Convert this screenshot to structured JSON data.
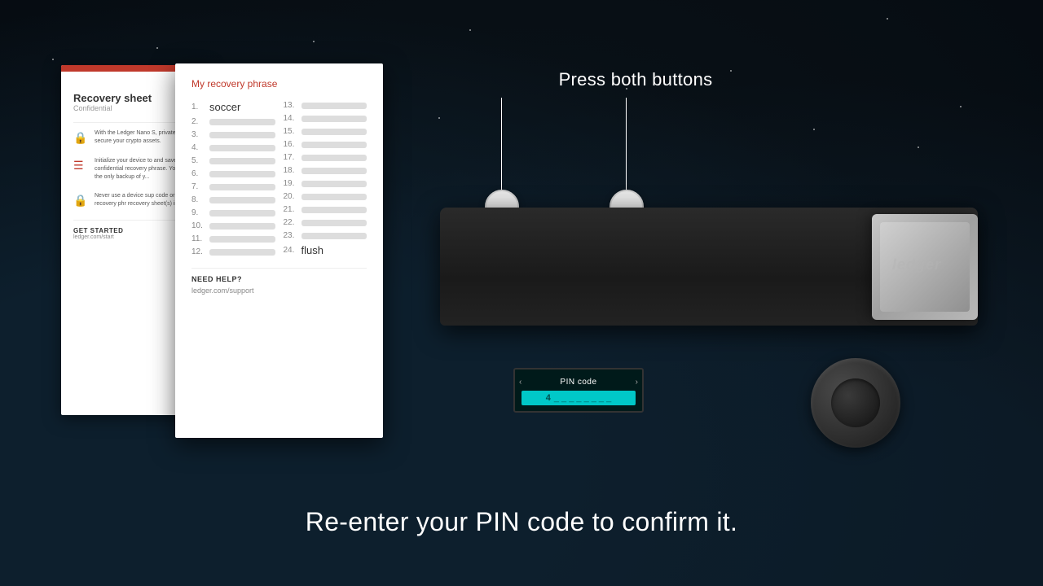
{
  "background": {
    "color": "#0a1520"
  },
  "recovery_sheet_back": {
    "title": "Recovery sheet",
    "subtitle": "Confidential",
    "section1_text": "With the Ledger Nano S, private keys to secure your crypto assets.",
    "section2_text": "Initialize your device to and save your confidential recovery phrase. Your is the only backup of y...",
    "section3_text": "Never use a device sup code or a recovery phr recovery sheet(s) in a s...",
    "get_started_label": "GET STARTED",
    "get_started_link": "ledger.com/start"
  },
  "recovery_card": {
    "title": "My recovery phrase",
    "word1": "soccer",
    "word24": "flush",
    "help_label": "NEED HELP?",
    "help_link": "ledger.com/support",
    "words": [
      {
        "num": "1.",
        "word": "soccer",
        "visible": true
      },
      {
        "num": "2.",
        "word": "",
        "visible": false
      },
      {
        "num": "3.",
        "word": "",
        "visible": false
      },
      {
        "num": "4.",
        "word": "",
        "visible": false
      },
      {
        "num": "5.",
        "word": "",
        "visible": false
      },
      {
        "num": "6.",
        "word": "",
        "visible": false
      },
      {
        "num": "7.",
        "word": "",
        "visible": false
      },
      {
        "num": "8.",
        "word": "",
        "visible": false
      },
      {
        "num": "9.",
        "word": "",
        "visible": false
      },
      {
        "num": "10.",
        "word": "",
        "visible": false
      },
      {
        "num": "11.",
        "word": "",
        "visible": false
      },
      {
        "num": "12.",
        "word": "",
        "visible": false
      },
      {
        "num": "13.",
        "word": "",
        "visible": false
      },
      {
        "num": "14.",
        "word": "",
        "visible": false
      },
      {
        "num": "15.",
        "word": "",
        "visible": false
      },
      {
        "num": "16.",
        "word": "",
        "visible": false
      },
      {
        "num": "17.",
        "word": "",
        "visible": false
      },
      {
        "num": "18.",
        "word": "",
        "visible": false
      },
      {
        "num": "19.",
        "word": "",
        "visible": false
      },
      {
        "num": "20.",
        "word": "",
        "visible": false
      },
      {
        "num": "21.",
        "word": "",
        "visible": false
      },
      {
        "num": "22.",
        "word": "",
        "visible": false
      },
      {
        "num": "23.",
        "word": "",
        "visible": false
      },
      {
        "num": "24.",
        "word": "flush",
        "visible": true
      }
    ]
  },
  "device": {
    "press_buttons_label": "Press both buttons",
    "screen_title": "PIN code",
    "screen_digit": "4",
    "screen_dashes": "_ _ _ _ _ _ _ _",
    "ledger_logo": "ledger"
  },
  "subtitle": {
    "text": "Re-enter your PIN code to confirm it."
  }
}
